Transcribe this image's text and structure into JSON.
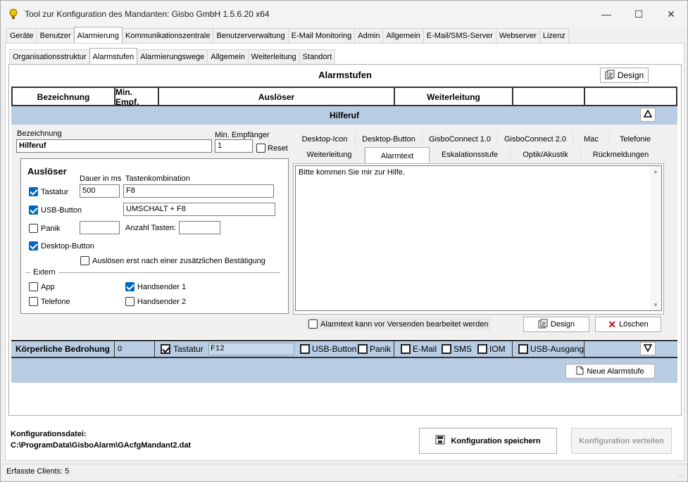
{
  "window": {
    "title": "Tool zur Konfiguration des Mandanten: Gisbo GmbH 1.5.6.20 x64"
  },
  "main_tabs": [
    "Geräte",
    "Benutzer",
    "Alarmierung",
    "Kommunikationszentrale",
    "Benutzerverwaltung",
    "E-Mail Monitoring",
    "Admin",
    "Allgemein",
    "E-Mail/SMS-Server",
    "Webserver",
    "Lizenz"
  ],
  "sub_tabs": [
    "Organisationsstruktur",
    "Alarmstufen",
    "Alarmierungswege",
    "Allgemein",
    "Weiterleitung",
    "Standort"
  ],
  "page": {
    "title": "Alarmstufen",
    "design_label": "Design"
  },
  "table_headers": {
    "bezeichnung": "Bezeichnung",
    "min_empf": "Min. Empf.",
    "ausloeser": "Auslöser",
    "weiterleitung": "Weiterleitung"
  },
  "section1": {
    "title": "Hilferuf"
  },
  "form": {
    "bezeichnung_label": "Bezeichnung",
    "bezeichnung_value": "Hilferuf",
    "min_empf_label": "Min. Empfänger",
    "min_empf_value": "1",
    "reset_label": "Reset"
  },
  "ausloeser": {
    "title": "Auslöser",
    "dauer_label": "Dauer in ms",
    "tasten_label": "Tastenkombination",
    "tastatur_label": "Tastatur",
    "tastatur_dauer": "500",
    "tastatur_kombi": "F8",
    "usb_label": "USB-Button",
    "usb_kombi": "UMSCHALT + F8",
    "panik_label": "Panik",
    "anzahl_label": "Anzahl Tasten:",
    "desktop_button_label": "Desktop-Button",
    "bestaetigung_label": "Auslösen erst nach einer zusätzlichen Bestätigung",
    "extern_label": "Extern",
    "app_label": "App",
    "telefone_label": "Telefone",
    "handsender1_label": "Handsender 1",
    "handsender2_label": "Handsender 2"
  },
  "detail_tabs_row1": [
    "Desktop-Icon",
    "Desktop-Button",
    "GisboConnect 1.0",
    "GisboConnect 2.0",
    "Mac",
    "Telefonie"
  ],
  "detail_tabs_row2": [
    "Weiterleitung",
    "Alarmtext",
    "Eskalationsstufe",
    "Optik/Akustik",
    "Rückmeldungen"
  ],
  "alarmtext": {
    "text": "Bitte kommen Sie mir zur Hilfe.",
    "editable_label": "Alarmtext kann vor Versenden bearbeitet werden",
    "design_label": "Design",
    "delete_label": "Löschen"
  },
  "section2": {
    "title": "Körperliche Bedrohung",
    "min_empf": "0",
    "tastatur_label": "Tastatur",
    "tastatur_value": "F12",
    "usb_label": "USB-Button",
    "panik_label": "Panik",
    "email_label": "E-Mail",
    "sms_label": "SMS",
    "iom_label": "IOM",
    "usb_ausgang_label": "USB-Ausgang"
  },
  "new_level_label": "Neue Alarmstufe",
  "footer": {
    "config_label": "Konfigurationsdatei:",
    "config_path": "C:\\ProgramData\\GisboAlarm\\GAcfgMandant2.dat",
    "save_label": "Konfiguration speichern",
    "distribute_label": "Konfiguration verteilen"
  },
  "status": {
    "clients": "Erfasste Clients: 5"
  },
  "colors": {
    "section_band": "#b8cce4",
    "accent": "#0067c0"
  }
}
